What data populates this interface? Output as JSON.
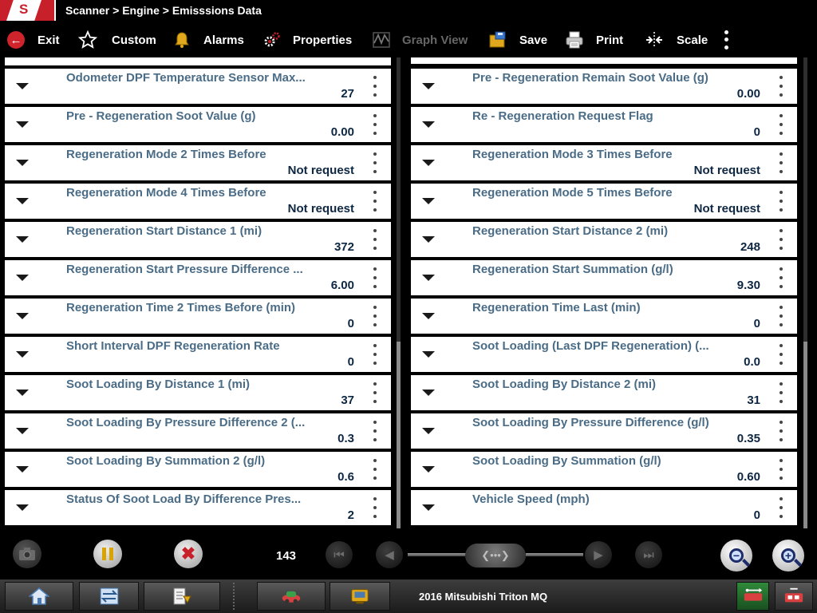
{
  "title": {
    "logo_text": "S",
    "breadcrumb": "Scanner > Engine > Emisssions Data"
  },
  "toolbar": {
    "exit": "Exit",
    "custom": "Custom",
    "alarms": "Alarms",
    "properties": "Properties",
    "graph_view": "Graph View",
    "save": "Save",
    "print": "Print",
    "scale": "Scale"
  },
  "left_rows": [
    {
      "name": "Odometer DPF Temperature Sensor Max...",
      "value": "27"
    },
    {
      "name": "Pre - Regeneration Soot Value (g)",
      "value": "0.00"
    },
    {
      "name": "Regeneration Mode 2 Times Before",
      "value": "Not request"
    },
    {
      "name": "Regeneration Mode 4 Times Before",
      "value": "Not request"
    },
    {
      "name": "Regeneration Start Distance 1 (mi)",
      "value": "372"
    },
    {
      "name": "Regeneration Start Pressure Difference ...",
      "value": "6.00"
    },
    {
      "name": "Regeneration Time 2 Times Before (min)",
      "value": "0"
    },
    {
      "name": "Short Interval DPF Regeneration Rate",
      "value": "0"
    },
    {
      "name": "Soot Loading By Distance 1 (mi)",
      "value": "37"
    },
    {
      "name": "Soot Loading By Pressure Difference 2 (...",
      "value": "0.3"
    },
    {
      "name": "Soot Loading By Summation 2 (g/l)",
      "value": "0.6"
    },
    {
      "name": "Status Of Soot Load By Difference Pres...",
      "value": "2"
    }
  ],
  "right_rows": [
    {
      "name": "Pre - Regeneration Remain Soot Value (g)",
      "value": "0.00"
    },
    {
      "name": "Re - Regeneration Request Flag",
      "value": "0"
    },
    {
      "name": "Regeneration Mode 3 Times Before",
      "value": "Not request"
    },
    {
      "name": "Regeneration Mode 5 Times Before",
      "value": "Not request"
    },
    {
      "name": "Regeneration Start Distance 2 (mi)",
      "value": "248"
    },
    {
      "name": "Regeneration Start Summation (g/l)",
      "value": "9.30"
    },
    {
      "name": "Regeneration Time Last (min)",
      "value": "0"
    },
    {
      "name": "Soot Loading (Last DPF Regeneration) (...",
      "value": "0.0"
    },
    {
      "name": "Soot Loading By Distance 2 (mi)",
      "value": "31"
    },
    {
      "name": "Soot Loading By Pressure Difference (g/l)",
      "value": "0.35"
    },
    {
      "name": "Soot Loading By Summation (g/l)",
      "value": "0.60"
    },
    {
      "name": "Vehicle Speed (mph)",
      "value": "0"
    }
  ],
  "playback": {
    "frame_counter": "143"
  },
  "taskbar": {
    "vehicle": "2016 Mitsubishi Triton MQ"
  },
  "colors": {
    "accent_red": "#c8202a",
    "param_name": "#4a6c86",
    "param_value": "#0d2642"
  }
}
